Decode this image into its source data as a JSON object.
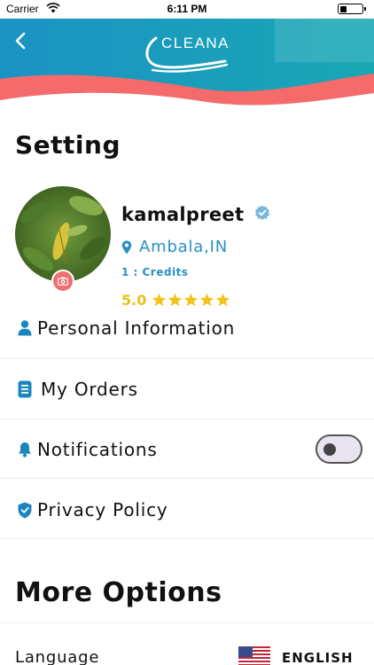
{
  "status_bar": {
    "carrier": "Carrier",
    "time": "6:11 PM"
  },
  "header": {
    "logo_text": "CLEANA",
    "back_icon": "chevron-left-icon"
  },
  "page": {
    "title": "Setting"
  },
  "profile": {
    "name": "kamalpreet",
    "location": "Ambala,IN",
    "credits": "1 : Credits",
    "rating": "5.0",
    "stars": 5
  },
  "menu": [
    {
      "label": "Personal Information",
      "icon": "user-icon"
    },
    {
      "label": "My Orders",
      "icon": "orders-icon"
    },
    {
      "label": "Notifications",
      "icon": "bell-icon",
      "toggle": false
    },
    {
      "label": "Privacy Policy",
      "icon": "shield-check-icon"
    }
  ],
  "more_options": {
    "title": "More Options",
    "language_label": "Language",
    "language_value": "ENGLISH"
  },
  "colors": {
    "teal": "#1a9fc6",
    "coral": "#f06f6f",
    "link_blue": "#2a8fc7",
    "star_yellow": "#f2c318"
  }
}
